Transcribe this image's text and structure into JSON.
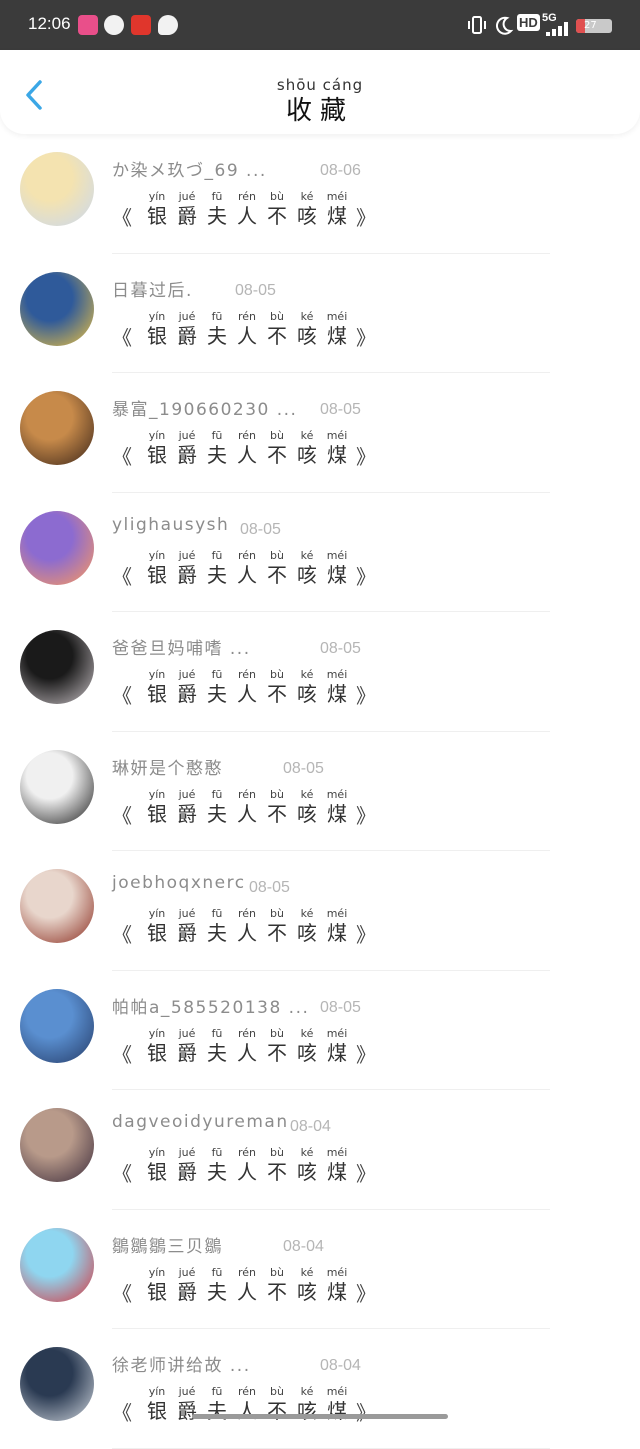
{
  "status_bar": {
    "time": "12:06",
    "network": "5G",
    "hd": "HD",
    "battery": "27"
  },
  "header": {
    "title_pinyin": "shōu cáng",
    "title": "收藏"
  },
  "content_ruby": [
    {
      "py": "yín",
      "hz": "银"
    },
    {
      "py": "jué",
      "hz": "爵"
    },
    {
      "py": "fū",
      "hz": "夫"
    },
    {
      "py": "rén",
      "hz": "人"
    },
    {
      "py": "bù",
      "hz": "不"
    },
    {
      "py": "ké",
      "hz": "咳"
    },
    {
      "py": "méi",
      "hz": "煤"
    }
  ],
  "brackets": {
    "open": "《",
    "close": "》"
  },
  "items": [
    {
      "name": "か染メ玖づ_69 ...",
      "date": "08-06",
      "avatar": [
        "#f4e3b0",
        "#c9d8f0"
      ]
    },
    {
      "name": "日暮过后.",
      "date": "08-05",
      "avatar": [
        "#2f5a9a",
        "#f1c53e"
      ]
    },
    {
      "name": "暴富_190660230 ...",
      "date": "08-05",
      "avatar": [
        "#c78a4a",
        "#3a2418"
      ]
    },
    {
      "name": "ylighausysh",
      "date": "08-05",
      "avatar": [
        "#8c6bd0",
        "#ff9a5a"
      ]
    },
    {
      "name": "爸爸旦妈哺嗜 ...",
      "date": "08-05",
      "avatar": [
        "#1a1a1a",
        "#c9c2c6"
      ]
    },
    {
      "name": "琳妍是个憨憨",
      "date": "08-05",
      "avatar": [
        "#f0f0f0",
        "#1c1c1c"
      ]
    },
    {
      "name": "joebhoqxnerc",
      "date": "08-05",
      "avatar": [
        "#e8d6cc",
        "#8a2b1e"
      ]
    },
    {
      "name": "帕帕a_585520138 ...",
      "date": "08-05",
      "avatar": [
        "#5a8fd0",
        "#243a66"
      ]
    },
    {
      "name": "dagveoidyureman",
      "date": "08-04",
      "avatar": [
        "#b89a8a",
        "#3a2a3a"
      ]
    },
    {
      "name": "鶵鶵鶵三贝鶵",
      "date": "08-04",
      "avatar": [
        "#8fd6f0",
        "#d8323a"
      ]
    },
    {
      "name": "徐老师讲给故 ...",
      "date": "08-04",
      "avatar": [
        "#2a3a52",
        "#d0d6de"
      ]
    }
  ]
}
